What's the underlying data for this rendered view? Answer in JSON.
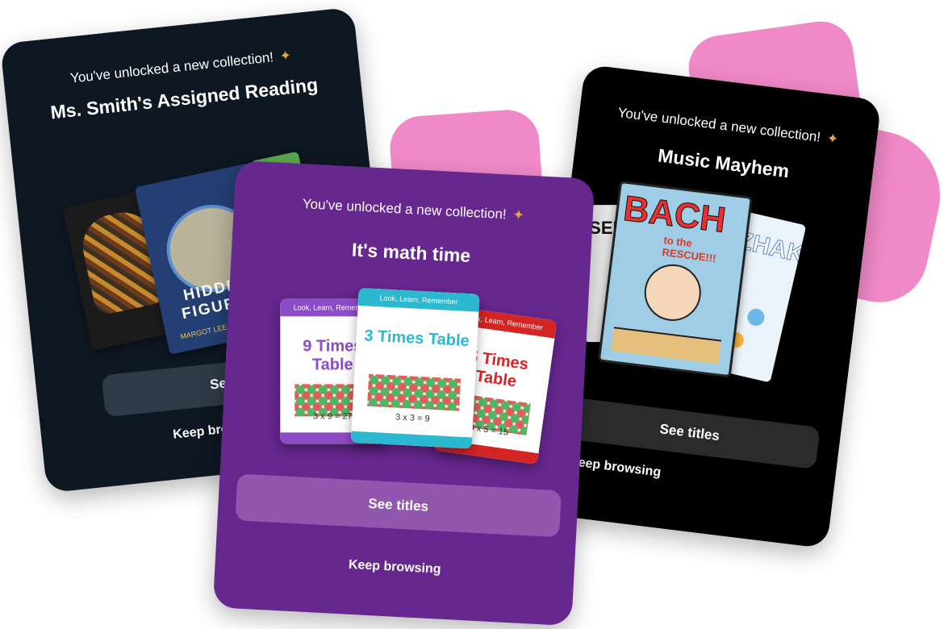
{
  "cards": {
    "reading": {
      "subtitle": "You've unlocked a new collection!",
      "title": "Ms. Smith's Assigned Reading",
      "see_titles_label": "See titles",
      "keep_browsing_label": "Keep browsing",
      "book_hidden_title": "HIDDEN FIGURES",
      "book_hidden_author": "MARGOT LEE SHETTERLY"
    },
    "math": {
      "subtitle": "You've unlocked a new collection!",
      "title": "It's math time",
      "see_titles_label": "See titles",
      "keep_browsing_label": "Keep browsing",
      "book_header": "Look, Learn, Remember",
      "book_9_title": "9 Times Table",
      "book_3_title": "3 Times Table",
      "book_5_title": "5 Times Table",
      "book_9_eq": "3 x 9 = 27",
      "book_3_eq": "3 x 3 = 9",
      "book_5_eq": "3 x 5 = 15"
    },
    "music": {
      "subtitle": "You've unlocked a new collection!",
      "title": "Music Mayhem",
      "see_titles_label": "See titles",
      "keep_browsing_label": "Keep browsing",
      "book_bach_title": "BACH",
      "book_bach_subtitle": "to the RESCUE!!!",
      "book_dvorak_title": "ZHAK"
    }
  },
  "colors": {
    "reading_bg": "#0e1823",
    "math_bg": "#66278f",
    "music_bg": "#000000",
    "blob": "#f089c8"
  },
  "icons": {
    "celebration": "party-popper-icon"
  }
}
